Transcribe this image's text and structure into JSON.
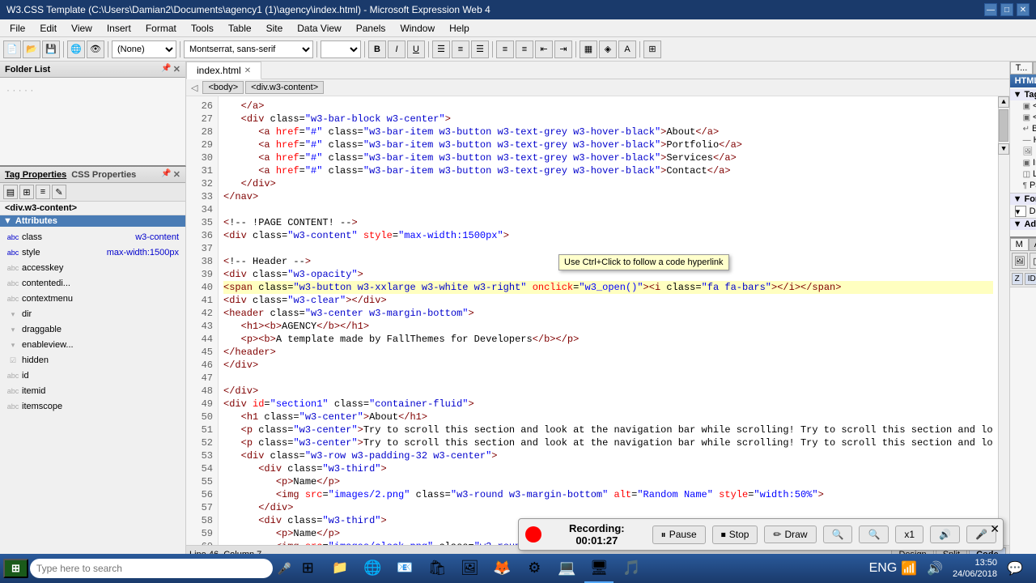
{
  "title_bar": {
    "title": "W3.CSS Template (C:\\Users\\Damian2\\Documents\\agency1 (1)\\agency\\index.html) - Microsoft Expression Web 4",
    "minimize": "—",
    "maximize": "□",
    "close": "✕"
  },
  "menu": {
    "items": [
      "File",
      "Edit",
      "View",
      "Insert",
      "Format",
      "Tools",
      "Table",
      "Site",
      "Data View",
      "Panels",
      "Window",
      "Help"
    ]
  },
  "toolbar": {
    "style_dropdown": "(None)",
    "font_dropdown": "Montserrat, sans-serif",
    "size_dropdown": ""
  },
  "folder_list": {
    "title": "Folder List",
    "content": "· · · · ·"
  },
  "tabs": {
    "active_tab": "index.html"
  },
  "breadcrumb": {
    "items": [
      "<body>",
      "<div.w3-content>"
    ]
  },
  "code_lines": {
    "start": 26,
    "lines": [
      {
        "num": 26,
        "content": "   </a>",
        "highlight": false
      },
      {
        "num": 27,
        "content": "   <div class=\"w3-bar-block w3-center\">",
        "highlight": false
      },
      {
        "num": 28,
        "content": "      <a href=\"#\" class=\"w3-bar-item w3-button w3-text-grey w3-hover-black\">About</a>",
        "highlight": false
      },
      {
        "num": 29,
        "content": "      <a href=\"#\" class=\"w3-bar-item w3-button w3-text-grey w3-hover-black\">Portfolio</a>",
        "highlight": false
      },
      {
        "num": 30,
        "content": "      <a href=\"#\" class=\"w3-bar-item w3-button w3-text-grey w3-hover-black\">Services</a>",
        "highlight": false
      },
      {
        "num": 31,
        "content": "      <a href=\"#\" class=\"w3-bar-item w3-button w3-text-grey w3-hover-black\">Contact</a>",
        "highlight": false
      },
      {
        "num": 32,
        "content": "   </div>",
        "highlight": false
      },
      {
        "num": 33,
        "content": "</nav>",
        "highlight": false
      },
      {
        "num": 34,
        "content": "",
        "highlight": false
      },
      {
        "num": 35,
        "content": "<!-- !PAGE CONTENT! -->",
        "highlight": false
      },
      {
        "num": 36,
        "content": "<div class=\"w3-content\" style=\"max-width:1500px\">",
        "highlight": false
      },
      {
        "num": 37,
        "content": "",
        "highlight": false
      },
      {
        "num": 38,
        "content": "<!-- Header -->",
        "highlight": false
      },
      {
        "num": 39,
        "content": "<div class=\"w3-opacity\">",
        "highlight": false
      },
      {
        "num": 40,
        "content": "<span class=\"w3-button w3-xxlarge w3-white w3-right\" onclick=\"w3_open()\"><i class=\"fa fa-bars\"></i></span>",
        "highlight": true
      },
      {
        "num": 41,
        "content": "<div class=\"w3-clear\"></div>",
        "highlight": false
      },
      {
        "num": 42,
        "content": "<header class=\"w3-center w3-margin-bottom\">",
        "highlight": false
      },
      {
        "num": 43,
        "content": "   <h1><b>AGENCY</b></h1>",
        "highlight": false
      },
      {
        "num": 44,
        "content": "   <p><b>A template made by FallThemes for Developers</b></p>",
        "highlight": false
      },
      {
        "num": 45,
        "content": "</header>",
        "highlight": false
      },
      {
        "num": 46,
        "content": "</div>",
        "highlight": false
      },
      {
        "num": 47,
        "content": "",
        "highlight": false
      },
      {
        "num": 48,
        "content": "</div>",
        "highlight": false
      },
      {
        "num": 49,
        "content": "<div id=\"section1\" class=\"container-fluid\">",
        "highlight": false
      },
      {
        "num": 50,
        "content": "   <h1 class=\"w3-center\">About</h1>",
        "highlight": false
      },
      {
        "num": 51,
        "content": "   <p class=\"w3-center\">Try to scroll this section and look at the navigation bar while scrolling! Try to scroll this section and lo",
        "highlight": false
      },
      {
        "num": 52,
        "content": "   <p class=\"w3-center\">Try to scroll this section and look at the navigation bar while scrolling! Try to scroll this section and lo",
        "highlight": false
      },
      {
        "num": 53,
        "content": "   <div class=\"w3-row w3-padding-32 w3-center\">",
        "highlight": false
      },
      {
        "num": 54,
        "content": "      <div class=\"w3-third\">",
        "highlight": false
      },
      {
        "num": 55,
        "content": "         <p>Name</p>",
        "highlight": false
      },
      {
        "num": 56,
        "content": "         <img src=\"images/2.png\" class=\"w3-round w3-margin-bottom\" alt=\"Random Name\" style=\"width:50%\">",
        "highlight": false
      },
      {
        "num": 57,
        "content": "      </div>",
        "highlight": false
      },
      {
        "num": 58,
        "content": "      <div class=\"w3-third\">",
        "highlight": false
      },
      {
        "num": 59,
        "content": "         <p>Name</p>",
        "highlight": false
      },
      {
        "num": 60,
        "content": "         <img src=\"images/clock.png\" class=\"w3-round w3-margin-bottom\" alt=\"Random Name\" style=\"width:50%\">",
        "highlight": false
      },
      {
        "num": 61,
        "content": "      </div>",
        "highlight": false
      },
      {
        "num": 62,
        "content": "      <div class=\"w3-third\">",
        "highlight": false
      }
    ]
  },
  "tooltip": {
    "text": "Use Ctrl+Click to follow a code hyperlink"
  },
  "right_panel": {
    "panel1": {
      "tabs": [
        "T...",
        "Sni..."
      ],
      "active_tab": "T...",
      "title": "HTML",
      "tags_header": "▼ Tags",
      "items": [
        "<div>",
        "<span>",
        "Break",
        "Horizontal ...",
        "Image",
        "Inline Frame",
        "Layer",
        "Paragraph"
      ]
    },
    "form_controls": {
      "header": "Form Controls",
      "items": [
        "Drop-Dow..."
      ]
    },
    "advanced": {
      "header": "Advanced"
    }
  },
  "tag_properties": {
    "title": "Tag Properties",
    "close": "✕"
  },
  "css_properties": {
    "title": "CSS Properties",
    "close": "✕"
  },
  "selected_element": {
    "label": "<div.w3-content>"
  },
  "attributes_panel": {
    "title": "Attributes",
    "items": [
      {
        "name": "class",
        "value": "w3-content"
      },
      {
        "name": "style",
        "value": "max-width:1500px"
      },
      {
        "name": "accesskey",
        "value": ""
      },
      {
        "name": "contentedi...",
        "value": ""
      },
      {
        "name": "contextmenu",
        "value": ""
      },
      {
        "name": "dir",
        "value": ""
      },
      {
        "name": "draggable",
        "value": ""
      },
      {
        "name": "enableview...",
        "value": ""
      },
      {
        "name": "hidden",
        "value": ""
      },
      {
        "name": "id",
        "value": ""
      },
      {
        "name": "itemid",
        "value": ""
      },
      {
        "name": "itemscope",
        "value": ""
      }
    ]
  },
  "view_tabs": {
    "design": "Design",
    "split": "Split",
    "code": "Code"
  },
  "status_bar": {
    "text": "Line 46, Column 7"
  },
  "recording": {
    "title": "Recording: 00:01:27",
    "pause": "Pause",
    "stop": "Stop",
    "draw": "Draw",
    "magnify": "x1"
  },
  "taskbar": {
    "start": "⊞",
    "search_placeholder": "Type here to search",
    "time": "13:50\n24/06/2018",
    "apps": [
      "💻",
      "📁",
      "🌐",
      "📧",
      "🎵",
      "🖼️",
      "🦊",
      "⚙️",
      "🖥️"
    ]
  },
  "right_panel2": {
    "tabs": [
      "M",
      "A..."
    ],
    "sub_tabs": [
      "Z",
      "ID"
    ],
    "icons": [
      "🖼️",
      "🔲",
      "🔳"
    ]
  }
}
